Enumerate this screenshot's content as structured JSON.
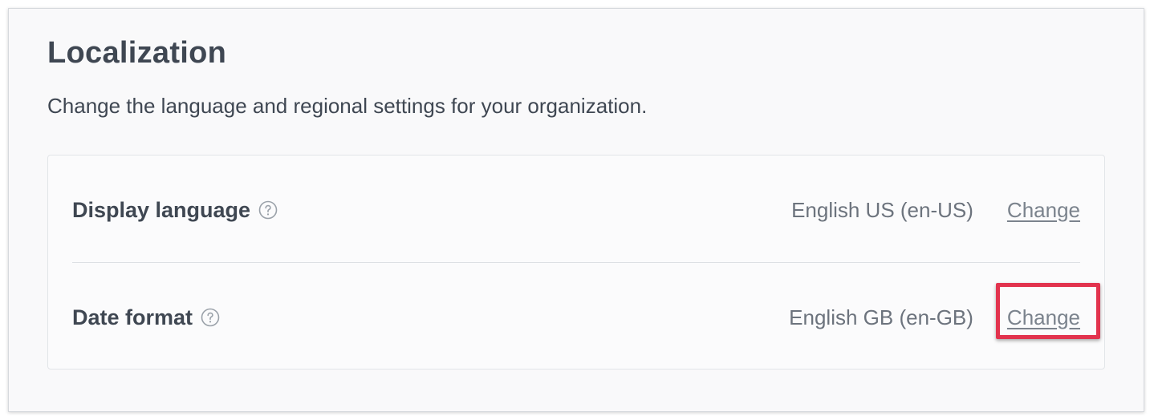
{
  "header": {
    "title": "Localization",
    "subtitle": "Change the language and regional settings for your organization."
  },
  "settings": [
    {
      "label": "Display language",
      "value": "English US (en-US)",
      "action_label": "Change",
      "help_icon": "question-circle-icon"
    },
    {
      "label": "Date format",
      "value": "English GB (en-GB)",
      "action_label": "Change",
      "help_icon": "question-circle-icon",
      "highlighted": true
    }
  ],
  "colors": {
    "text_primary": "#3f4752",
    "text_secondary": "#6c737d",
    "link": "#7b838d",
    "highlight": "#e2334e",
    "panel_bg": "#f9f9fa"
  }
}
